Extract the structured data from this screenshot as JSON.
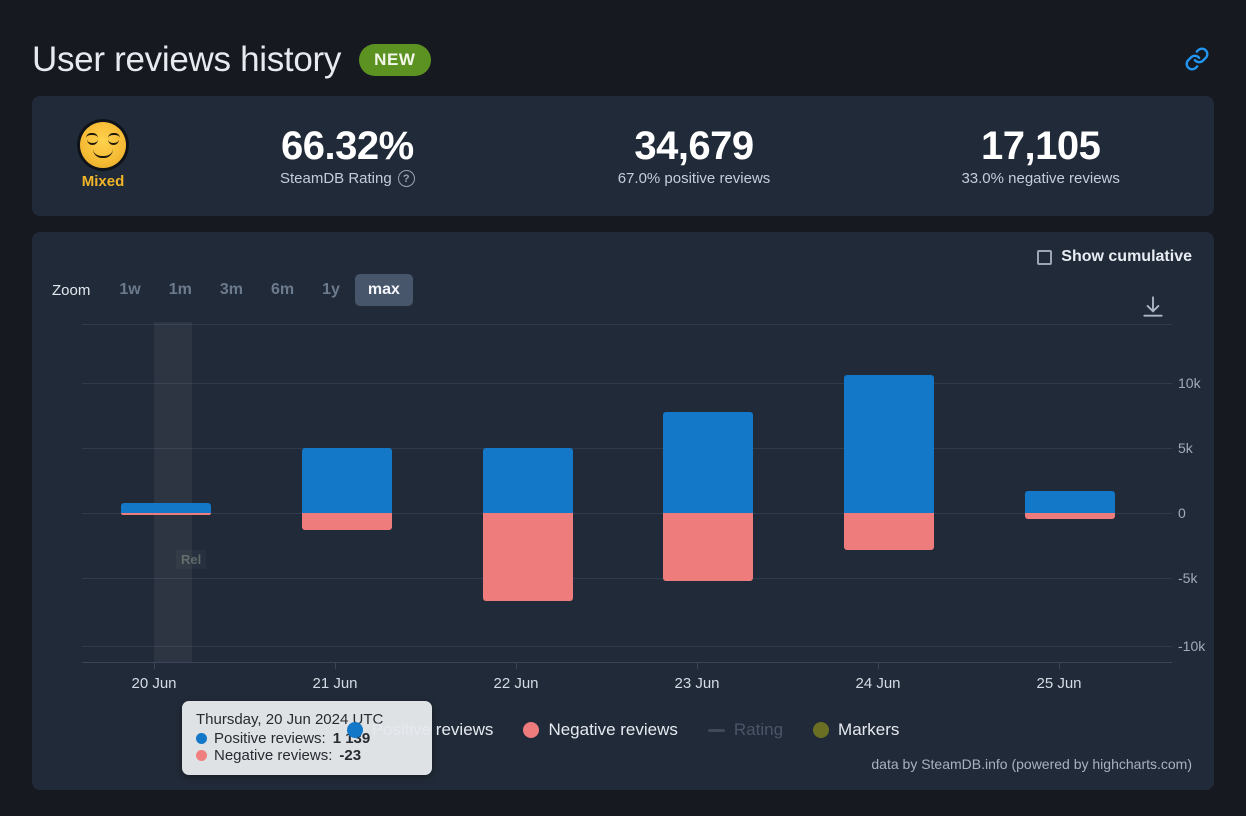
{
  "header": {
    "title": "User reviews history",
    "badge": "NEW",
    "link_icon": "link-icon"
  },
  "summary": {
    "verdict": "Mixed",
    "verdict_emoji": "relieved-face",
    "verdict_color": "#f0b429",
    "rating_value": "66.32%",
    "rating_label": "SteamDB Rating",
    "rating_help": "?",
    "positive_value": "34,679",
    "positive_label": "67.0% positive reviews",
    "negative_value": "17,105",
    "negative_label": "33.0% negative reviews"
  },
  "controls": {
    "cumulative_label": "Show cumulative",
    "cumulative_checked": false,
    "zoom_label": "Zoom",
    "zoom_options": [
      "1w",
      "1m",
      "3m",
      "6m",
      "1y",
      "max"
    ],
    "zoom_active": "max",
    "download_icon": "download-icon"
  },
  "tooltip": {
    "date": "Thursday, 20 Jun 2024 UTC",
    "rows": [
      {
        "label": "Positive reviews:",
        "value": "1 139",
        "color": "#1478c8"
      },
      {
        "label": "Negative reviews:",
        "value": "-23",
        "color": "#f08080"
      }
    ]
  },
  "legend": {
    "items": [
      {
        "label": "Positive reviews",
        "color": "#1478c8",
        "marker": "dot",
        "disabled": false
      },
      {
        "label": "Negative reviews",
        "color": "#ee7c7c",
        "marker": "dot",
        "disabled": false
      },
      {
        "label": "Rating",
        "color": "#3f4957",
        "marker": "line",
        "disabled": true
      },
      {
        "label": "Markers",
        "color": "#6b6f24",
        "marker": "dot",
        "disabled": false
      }
    ]
  },
  "credit": "data by SteamDB.info (powered by highcharts.com)",
  "chart_data": {
    "type": "bar",
    "title": "User reviews history",
    "xlabel": "",
    "ylabel": "",
    "grid": true,
    "legend_position": "bottom",
    "stacked": true,
    "categories": [
      "20 Jun",
      "21 Jun",
      "22 Jun",
      "23 Jun",
      "24 Jun",
      "25 Jun"
    ],
    "ylim": [
      -12500,
      15500
    ],
    "yticks": [
      -10000,
      -5000,
      0,
      5000,
      10000
    ],
    "ytick_labels": [
      "-10k",
      "-5k",
      "0",
      "5k",
      "10k"
    ],
    "series": [
      {
        "name": "Positive reviews",
        "color": "#1478c8",
        "values": [
          1139,
          5600,
          5500,
          8600,
          10800,
          1700
        ]
      },
      {
        "name": "Negative reviews",
        "color": "#ee7c7c",
        "values": [
          -23,
          -700,
          -7000,
          -5200,
          -2900,
          -300
        ]
      },
      {
        "name": "Rating",
        "color": "#3f4957",
        "values": [],
        "disabled": true
      }
    ],
    "plot_band": {
      "label": "Rel",
      "from": "20 Jun",
      "note": "release date marker"
    },
    "hovered_point": {
      "category": "20 Jun",
      "date": "Thursday, 20 Jun 2024 UTC",
      "positive": 1139,
      "negative": -23
    }
  }
}
